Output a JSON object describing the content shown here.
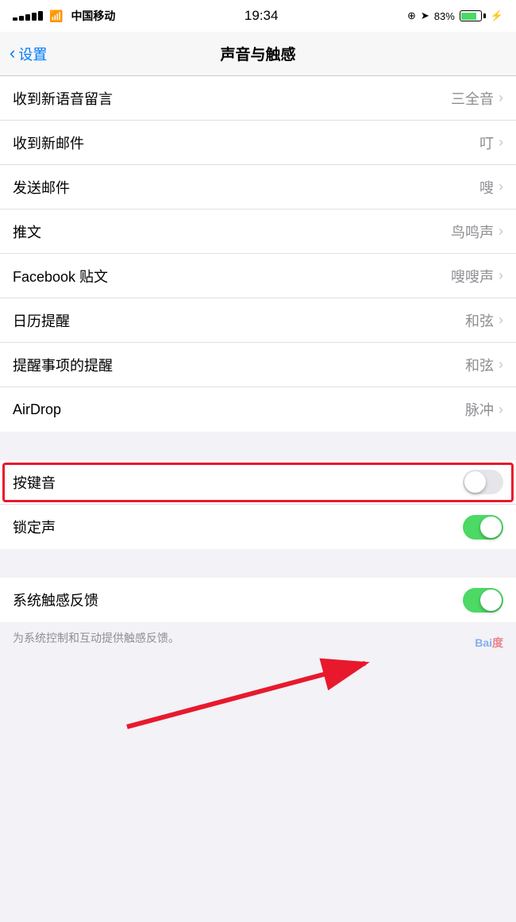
{
  "statusBar": {
    "carrier": "中国移动",
    "time": "19:34",
    "batteryPercent": "83%",
    "locationIcon": "→",
    "lockIcon": "⊕"
  },
  "header": {
    "backLabel": "设置",
    "title": "声音与触感"
  },
  "rows": [
    {
      "label": "收到新语音留言",
      "value": "三全音",
      "hasChevron": true
    },
    {
      "label": "收到新邮件",
      "value": "叮",
      "hasChevron": true
    },
    {
      "label": "发送邮件",
      "value": "嗖",
      "hasChevron": true
    },
    {
      "label": "推文",
      "value": "鸟鸣声",
      "hasChevron": true
    },
    {
      "label": "Facebook 贴文",
      "value": "嗖嗖声",
      "hasChevron": true
    },
    {
      "label": "日历提醒",
      "value": "和弦",
      "hasChevron": true
    },
    {
      "label": "提醒事项的提醒",
      "value": "和弦",
      "hasChevron": true
    },
    {
      "label": "AirDrop",
      "value": "脉冲",
      "hasChevron": true
    }
  ],
  "toggleRows": [
    {
      "label": "按键音",
      "state": "off"
    },
    {
      "label": "锁定声",
      "state": "on"
    }
  ],
  "thirdSection": [
    {
      "label": "系统触感反馈",
      "state": "on"
    }
  ],
  "footerText": "为系统控制和互动提供触感反馈。",
  "baiduMark": "Bai度"
}
